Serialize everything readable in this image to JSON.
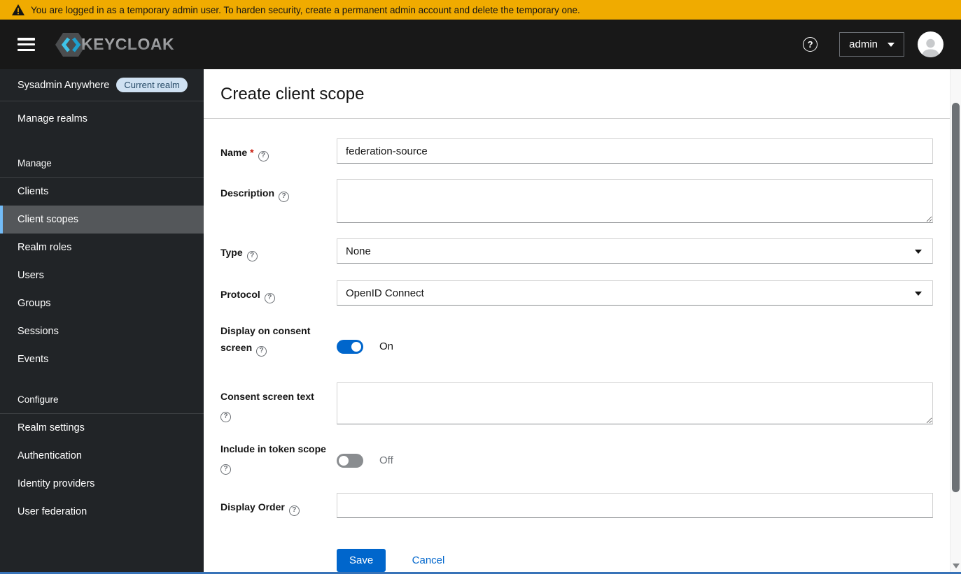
{
  "banner": {
    "text": "You are logged in as a temporary admin user. To harden security, create a permanent admin account and delete the temporary one."
  },
  "header": {
    "logo_text": "KEYCLOAK",
    "help_icon_glyph": "?",
    "user_menu_label": "admin"
  },
  "sidebar": {
    "realm_name": "Sysadmin Anywhere",
    "realm_badge": "Current realm",
    "manage_realms_label": "Manage realms",
    "active_item": "Client scopes",
    "sections": [
      {
        "heading": "Manage",
        "items": [
          "Clients",
          "Client scopes",
          "Realm roles",
          "Users",
          "Groups",
          "Sessions",
          "Events"
        ]
      },
      {
        "heading": "Configure",
        "items": [
          "Realm settings",
          "Authentication",
          "Identity providers",
          "User federation"
        ]
      }
    ]
  },
  "main": {
    "title": "Create client scope",
    "help_icon_glyph": "?",
    "form": {
      "fields": [
        {
          "label": "Name",
          "required_marker": "*",
          "control": "text",
          "value": "federation-source"
        },
        {
          "label": "Description",
          "control": "textarea",
          "value": ""
        },
        {
          "label": "Type",
          "control": "select",
          "value": "None"
        },
        {
          "label": "Protocol",
          "control": "select",
          "value": "OpenID Connect"
        },
        {
          "label": "Display on consent screen",
          "control": "toggle",
          "state": "on",
          "state_label": "On"
        },
        {
          "label": "Consent screen text",
          "control": "textarea",
          "value": ""
        },
        {
          "label": "Include in token scope",
          "control": "toggle",
          "state": "off",
          "state_label": "Off"
        },
        {
          "label": "Display Order",
          "control": "text",
          "value": ""
        }
      ],
      "actions": {
        "save": "Save",
        "cancel": "Cancel"
      }
    }
  },
  "colors": {
    "accent_blue": "#0066cc",
    "banner_gold": "#f0ab00",
    "sidebar_bg": "#212427",
    "active_item_border": "#73bcf7",
    "toggle_off_gray": "#8a8d90"
  }
}
